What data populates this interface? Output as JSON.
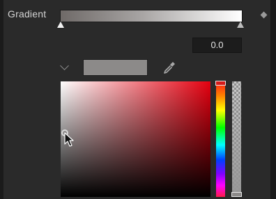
{
  "gradient": {
    "label": "Gradient",
    "position_value": "0.0"
  },
  "color": {
    "swatch": "#8c8a89",
    "hue_color": "#d61a1a"
  },
  "icons": [
    "chevron-down-icon",
    "eyedropper-icon",
    "keyframe-diamond-icon",
    "mouse-cursor-icon"
  ]
}
